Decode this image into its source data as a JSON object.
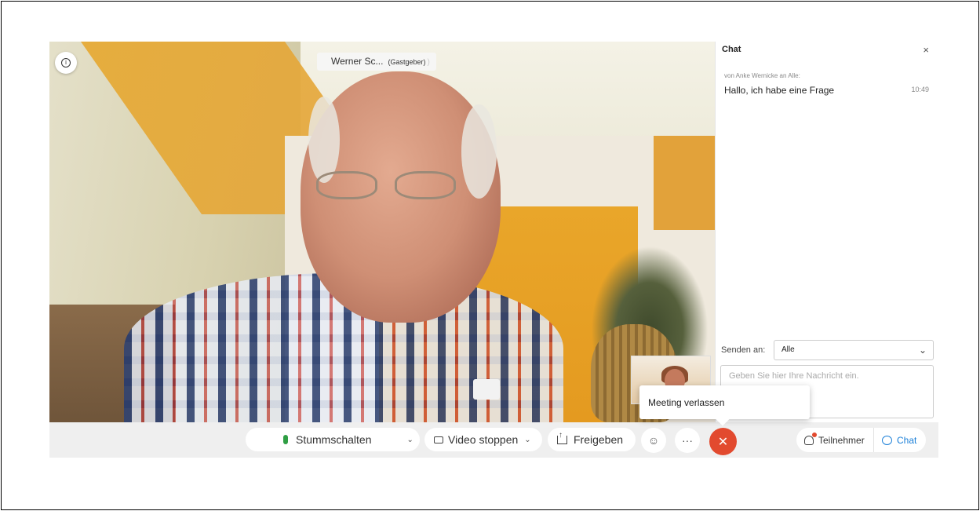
{
  "video": {
    "speaker_name": "Werner Sc...",
    "speaker_role": "(Gastgeber)"
  },
  "chat": {
    "title": "Chat",
    "close_label": "×",
    "messages": [
      {
        "meta": "von Anke Wernicke an Alle:",
        "text": "Hallo, ich habe eine Frage",
        "time": "10:49"
      }
    ],
    "send_to_label": "Senden an:",
    "send_to_value": "Alle",
    "input_placeholder": "Geben Sie hier Ihre Nachricht ein."
  },
  "toolbar": {
    "mute_label": "Stummschalten",
    "video_label": "Video stoppen",
    "share_label": "Freigeben",
    "more_label": "···",
    "leave_tooltip": "Meeting verlassen",
    "participants_label": "Teilnehmer",
    "chat_label": "Chat"
  },
  "colors": {
    "leave_red": "#e24a2f",
    "chat_blue": "#1a7fd8",
    "mic_green": "#2f9e44"
  }
}
